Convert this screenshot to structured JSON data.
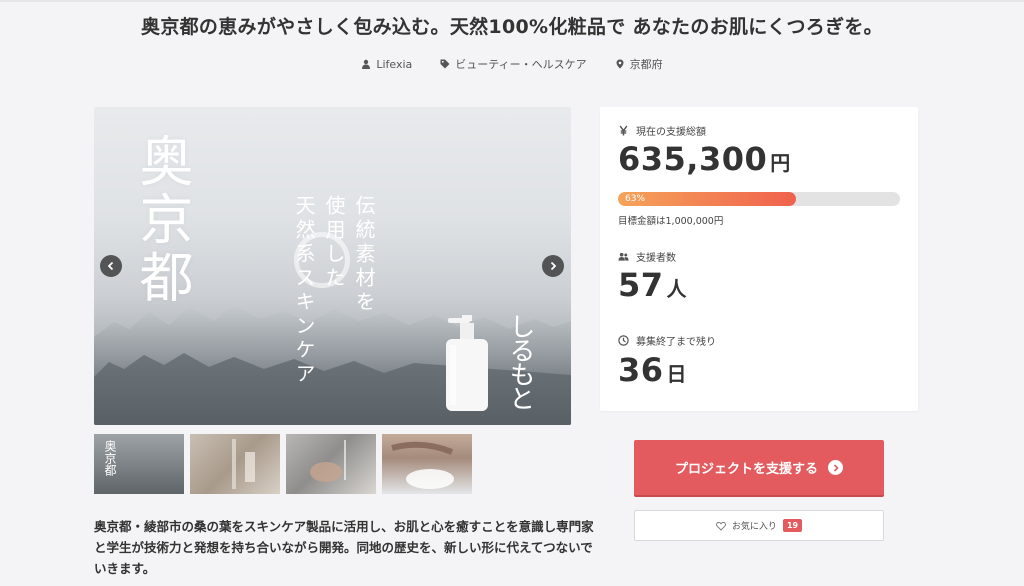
{
  "page": {
    "title": "奥京都の恵みがやさしく包み込む。天然100%化粧品で あなたのお肌にくつろぎを。"
  },
  "meta": {
    "author": "Lifexia",
    "category": "ビューティー・ヘルスケア",
    "location": "京都府"
  },
  "hero": {
    "big_text": "奥京都",
    "vertical_lines": [
      "伝統素材を",
      "使用した",
      "天然系スキンケア"
    ],
    "brand_mark": "しるもと",
    "prev_icon": "chevron-left-icon",
    "next_icon": "chevron-right-icon"
  },
  "thumbnails": [
    {
      "label": "奥京都"
    },
    {
      "label": ""
    },
    {
      "label": ""
    },
    {
      "label": ""
    }
  ],
  "description": "奥京都・綾部市の桑の葉をスキンケア製品に活用し、お肌と心を癒すことを意識し専門家と学生が技術力と発想を持ち合いながら開発。同地の歴史を、新しい形に代えてつないでいきます。",
  "stats": {
    "total_label": "現在の支援総額",
    "total_value": "635,300",
    "total_unit": "円",
    "progress_percent": 63,
    "progress_text": "63%",
    "goal_text": "目標金額は1,000,000円",
    "backers_label": "支援者数",
    "backers_value": "57",
    "backers_unit": "人",
    "remaining_label": "募集終了まで残り",
    "remaining_value": "36",
    "remaining_unit": "日"
  },
  "actions": {
    "support_label": "プロジェクトを支援する",
    "favorite_label": "お気に入り",
    "favorite_count": "19"
  },
  "colors": {
    "accent": "#e35b5f",
    "progress_start": "#f5a35a",
    "progress_end": "#f0614d"
  }
}
